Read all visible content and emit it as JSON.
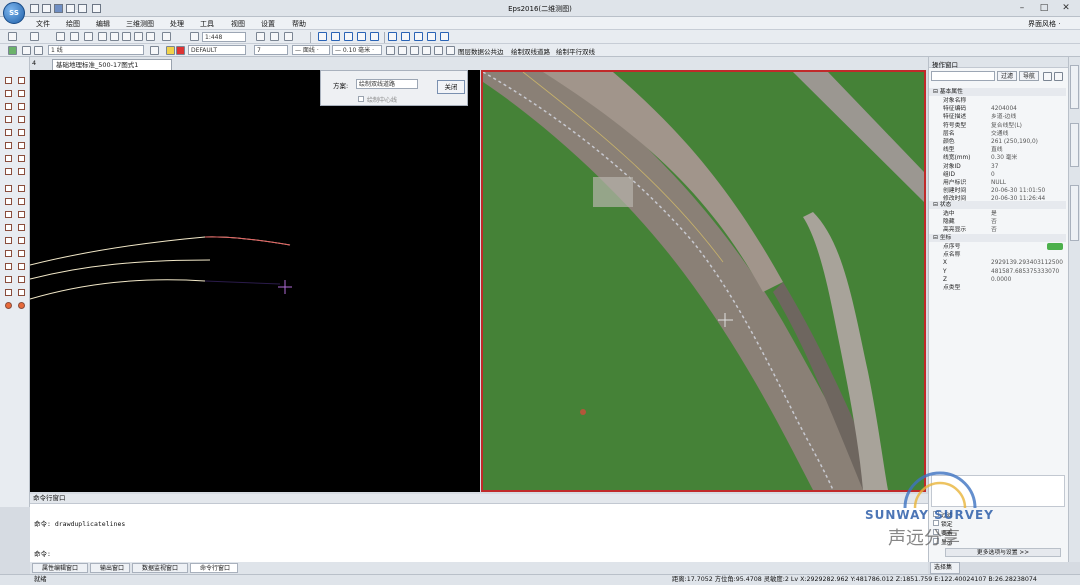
{
  "window": {
    "title": "Eps2016(二维测图)",
    "logo_text": "SS",
    "interface_style": "界面风格 ·"
  },
  "menus": [
    "文件",
    "绘图",
    "编辑",
    "三维测图",
    "处理",
    "工具",
    "视图",
    "设置",
    "帮助"
  ],
  "toolbar": {
    "scale": "1:448",
    "layer_count": "1 线",
    "layer_name": "DEFAULT",
    "color_index": "7",
    "line_type": "— 面线 ·",
    "line_width": "— 0.10 毫米 ·",
    "tools": [
      "图层数据公共边",
      "绘制双线道路",
      "绘制平行双线"
    ]
  },
  "document": {
    "tab_index": "4",
    "tab_label": "基础地理标准_500-17图式1"
  },
  "dialog": {
    "scheme_label": "方案:",
    "scheme_value": "绘制双线道路",
    "close_button": "关闭",
    "checkbox_label": "绘制中心线"
  },
  "right_panel": {
    "title": "操作窗口",
    "filter_button": "过滤",
    "nav_button": "导航",
    "sections": {
      "basic": "基本属性",
      "state": "状态",
      "coords": "坐标"
    },
    "basic_rows": [
      {
        "k": "对象名称",
        "v": ""
      },
      {
        "k": "特征编码",
        "v": "4204004"
      },
      {
        "k": "特征描述",
        "v": "乡道-边线"
      },
      {
        "k": "符号类型",
        "v": "复合线型(L)"
      },
      {
        "k": "层名",
        "v": "交通线"
      },
      {
        "k": "颜色",
        "v": "261 (250,190,0)"
      },
      {
        "k": "线型",
        "v": "直线"
      },
      {
        "k": "线宽(mm)",
        "v": "0.30 毫米"
      },
      {
        "k": "对象ID",
        "v": "37"
      },
      {
        "k": "组ID",
        "v": "0"
      },
      {
        "k": "用户标识",
        "v": "NULL"
      },
      {
        "k": "创建时间",
        "v": "20-06-30 11:01:50"
      },
      {
        "k": "修改时间",
        "v": "20-06-30 11:26:44"
      }
    ],
    "state_rows": [
      {
        "k": "选中",
        "v": "是"
      },
      {
        "k": "隐藏",
        "v": "否"
      },
      {
        "k": "高亮显示",
        "v": "否"
      },
      {
        "k": "灰色显示",
        "v": "否"
      }
    ],
    "coord_rows": [
      {
        "k": "点序号",
        "v": ""
      },
      {
        "k": "点名称",
        "v": ""
      },
      {
        "k": "X",
        "v": "2929139.293403112500"
      },
      {
        "k": "Y",
        "v": "481587.685375333070"
      },
      {
        "k": "Z",
        "v": "0.0000"
      },
      {
        "k": "点类型",
        "v": ""
      }
    ],
    "more_settings": "更多选项与设置 >>",
    "bottom_tab": "选择集",
    "checks": [
      "过滤",
      "锁定",
      "要素",
      "显示"
    ]
  },
  "command_window": {
    "title": "命令行窗口",
    "line1": "命令: drawduplicatelines",
    "line2": "命令:",
    "tabs": [
      "属性编辑窗口",
      "输出窗口",
      "数据监视窗口",
      "命令行窗口"
    ]
  },
  "status_bar": {
    "left": "就绪",
    "right": "距离:17.7052 方位角:95.4708 灵敏度:2 Lv   X:2929282.962 Y:481786.012 Z:1851.759 E:122.40024107 B:26.28238074"
  },
  "watermark": {
    "brand": "SUNWAY SURVEY",
    "caption": "声远分享"
  },
  "colors": {
    "canvas_bg": "#000000",
    "photo_border": "#c02a2a",
    "road_line_selected": "#e06060",
    "road_line": "#f2e8c8",
    "cursor": "#b06bd6"
  }
}
